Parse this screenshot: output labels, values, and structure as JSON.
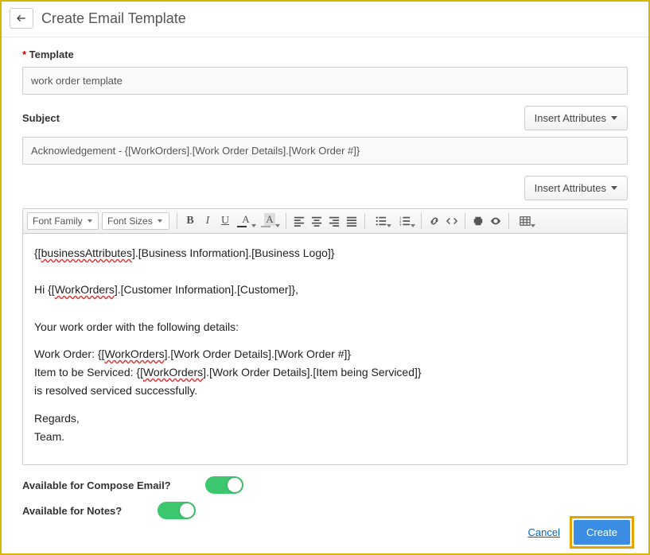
{
  "header": {
    "title": "Create Email Template"
  },
  "fields": {
    "template": {
      "label": "Template",
      "value": "work order template"
    },
    "subject": {
      "label": "Subject",
      "value": "Acknowledgement - {[WorkOrders].[Work Order Details].[Work Order #]}"
    }
  },
  "buttons": {
    "insert_attributes": "Insert Attributes"
  },
  "toolbar": {
    "font_family": "Font Family",
    "font_sizes": "Font Sizes"
  },
  "editor": {
    "l1a": "{[",
    "l1b": "businessAttributes",
    "l1c": "].[Business Information].[Business Logo]}",
    "l2a": "Hi {[",
    "l2b": "WorkOrders",
    "l2c": "].[Customer Information].[Customer]},",
    "l3": "Your work order with the following details:",
    "l4a": "Work Order: {[",
    "l4b": "WorkOrders",
    "l4c": "].[Work Order Details].[Work Order #]}",
    "l5a": "Item to be Serviced: {[",
    "l5b": "WorkOrders",
    "l5c": "].[Work Order Details].[Item being Serviced]}",
    "l6": "is resolved serviced successfully.",
    "l7": "Regards,",
    "l8": "Team."
  },
  "toggles": {
    "compose": {
      "label": "Available for Compose Email?",
      "on": true
    },
    "notes": {
      "label": "Available for Notes?",
      "on": true
    }
  },
  "footer": {
    "cancel": "Cancel",
    "create": "Create"
  }
}
